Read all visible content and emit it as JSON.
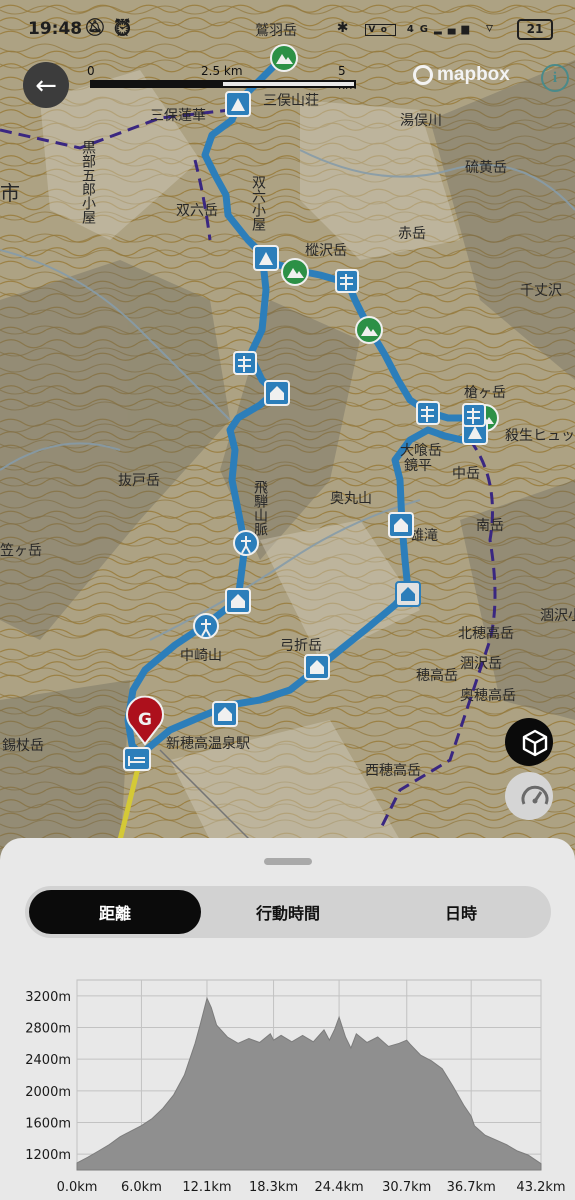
{
  "status_bar": {
    "time": "19:48",
    "left_icons": [
      "mute-icon",
      "alarm-icon"
    ],
    "right_icons": [
      "bluetooth-icon",
      "volte-icon",
      "signal-4g-icon",
      "wifi-icon"
    ],
    "battery": "21"
  },
  "map": {
    "scale_labels": [
      "0",
      "2.5 km",
      "5 km"
    ],
    "attribution": "mapbox",
    "labels": [
      "三保蓮華",
      "黒部五郎小屋",
      "双六小屋",
      "鷲羽岳",
      "三俣山荘",
      "双六岳",
      "樅沢岳",
      "赤岳",
      "湯俣川",
      "硫黄岳",
      "千丈沢",
      "槍ヶ岳",
      "殺生ヒュッテ",
      "大喰岳",
      "中岳",
      "南岳",
      "奥丸山",
      "抜戸岳",
      "笠ヶ岳",
      "飛騨山脈",
      "中崎山",
      "北穂高岳",
      "涸沢岳",
      "奥穂高岳",
      "涸沢小屋",
      "西穂高岳",
      "雄滝",
      "新穂高温泉駅",
      "錫杖岳",
      "弓折岳",
      "鏡平",
      "穂高岳",
      "市"
    ],
    "goal_marker": "G",
    "view_3d_icon": "cube-3d-icon",
    "speed_icon": "speedometer-icon"
  },
  "sheet": {
    "tabs": [
      {
        "label": "距離",
        "active": true
      },
      {
        "label": "行動時間",
        "active": false
      },
      {
        "label": "日時",
        "active": false
      }
    ]
  },
  "chart_data": {
    "type": "area",
    "title": "",
    "xlabel": "",
    "ylabel": "",
    "y_ticks": [
      "1200m",
      "1600m",
      "2000m",
      "2400m",
      "2800m",
      "3200m"
    ],
    "x_ticks": [
      "0.0km",
      "6.0km",
      "12.1km",
      "18.3km",
      "24.4km",
      "30.7km",
      "36.7km",
      "43.2km"
    ],
    "xlim": [
      0,
      43.2
    ],
    "ylim": [
      1000,
      3400
    ],
    "grid": true,
    "x": [
      0,
      1,
      2,
      3,
      4,
      5,
      6,
      7,
      8,
      9,
      10,
      11,
      11.5,
      12.1,
      12.5,
      13,
      14,
      15,
      16,
      17,
      18,
      18.3,
      19,
      20,
      21,
      22,
      23,
      23.5,
      24,
      24.4,
      25,
      25.5,
      26,
      27,
      28,
      29,
      30,
      30.7,
      31,
      32,
      33,
      34,
      35,
      36,
      36.7,
      37,
      38,
      39,
      40,
      41,
      42,
      43.2
    ],
    "y": [
      1090,
      1160,
      1240,
      1320,
      1420,
      1490,
      1560,
      1650,
      1780,
      1950,
      2200,
      2600,
      2850,
      3170,
      3050,
      2830,
      2680,
      2600,
      2660,
      2610,
      2720,
      2640,
      2700,
      2620,
      2700,
      2620,
      2770,
      2640,
      2780,
      2930,
      2680,
      2540,
      2720,
      2610,
      2680,
      2560,
      2600,
      2640,
      2590,
      2450,
      2380,
      2280,
      2060,
      1820,
      1680,
      1560,
      1440,
      1380,
      1320,
      1240,
      1190,
      1080
    ]
  }
}
